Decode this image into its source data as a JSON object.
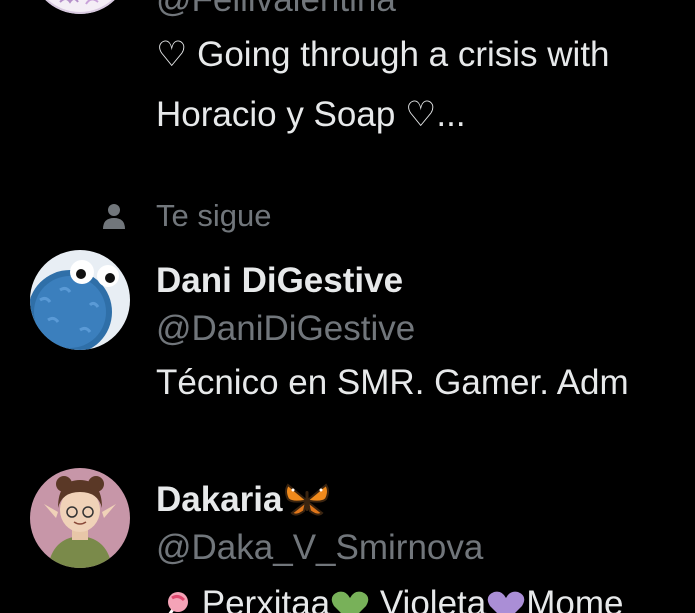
{
  "users": [
    {
      "handle": "@Feliivalentina",
      "bio_line1": "♡  Going through a crisis with",
      "bio_line2": "Horacio y Soap ♡..."
    },
    {
      "follows_you": "Te sigue",
      "name": "Dani DiGestive",
      "handle": "@DaniDiGestive",
      "bio": "Técnico en SMR. Gamer. Adm"
    },
    {
      "name": "Dakaria",
      "handle": "@Daka_V_Smirnova",
      "bio_part1": " Perxitaa",
      "bio_part2": " Violeta",
      "bio_part3": "Mome"
    }
  ],
  "colors": {
    "background": "#000000",
    "primary_text": "#e7e9ea",
    "secondary_text": "#71767b"
  },
  "icons": {
    "follows_you": "person-icon",
    "butterfly": "butterfly-emoji",
    "green_heart": "green-heart-emoji",
    "purple_heart": "purple-heart-emoji",
    "candy": "lollipop-emoji"
  }
}
